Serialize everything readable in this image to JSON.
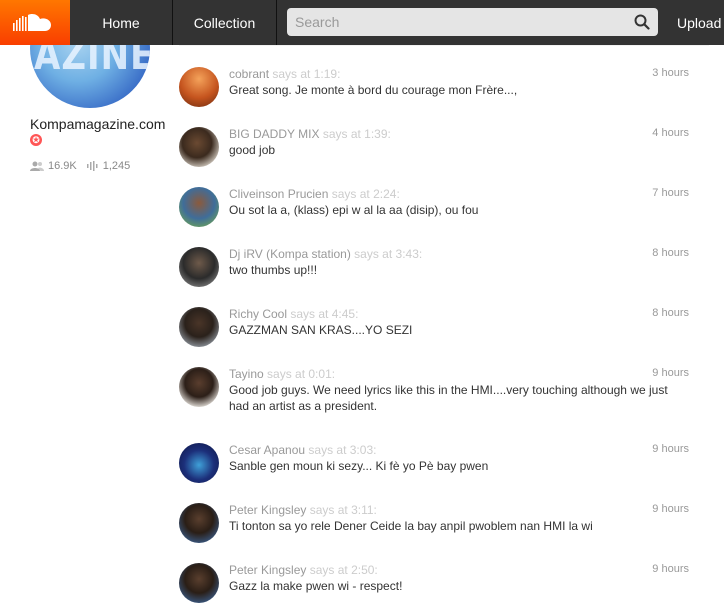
{
  "header": {
    "logo_icon": "soundcloud-logo-icon",
    "home_label": "Home",
    "collection_label": "Collection",
    "search_placeholder": "Search",
    "upload_label": "Upload"
  },
  "user": {
    "avatar_text": "AZINE",
    "name": "Kompamagazine.com",
    "badge": "pro-badge",
    "followers": "16.9K",
    "tracks": "1,245"
  },
  "comments": [
    {
      "name": "cobrant",
      "says": "says at 1:19:",
      "time": "3 hours",
      "text": "Great song. Je monte à bord du courage mon Frère...,"
    },
    {
      "name": "BIG DADDY MIX",
      "says": "says at 1:39:",
      "time": "4 hours",
      "text": "good job"
    },
    {
      "name": "Cliveinson Prucien",
      "says": "says at 2:24:",
      "time": "7 hours",
      "text": "Ou sot la a, (klass) epi w al la aa (disip), ou fou"
    },
    {
      "name": "Dj iRV (Kompa station)",
      "says": "says at 3:43:",
      "time": "8 hours",
      "text": "two thumbs up!!!"
    },
    {
      "name": "Richy Cool",
      "says": "says at 4:45:",
      "time": "8 hours",
      "text": "GAZZMAN SAN KRAS....YO SEZI"
    },
    {
      "name": "Tayino",
      "says": "says at 0:01:",
      "time": "9 hours",
      "text": "Good job guys. We need lyrics like this in the HMI....very touching although we just had an artist as a president."
    },
    {
      "name": "Cesar Apanou",
      "says": "says at 3:03:",
      "time": "9 hours",
      "text": "Sanble gen moun ki sezy... Ki fè yo Pè bay pwen"
    },
    {
      "name": "Peter Kingsley",
      "says": "says at 3:11:",
      "time": "9 hours",
      "text": "Ti tonton sa yo rele Dener Ceide la bay anpil pwoblem nan HMI la wi"
    },
    {
      "name": "Peter Kingsley",
      "says": "says at 2:50:",
      "time": "9 hours",
      "text": "Gazz la make pwen wi - respect!"
    }
  ]
}
